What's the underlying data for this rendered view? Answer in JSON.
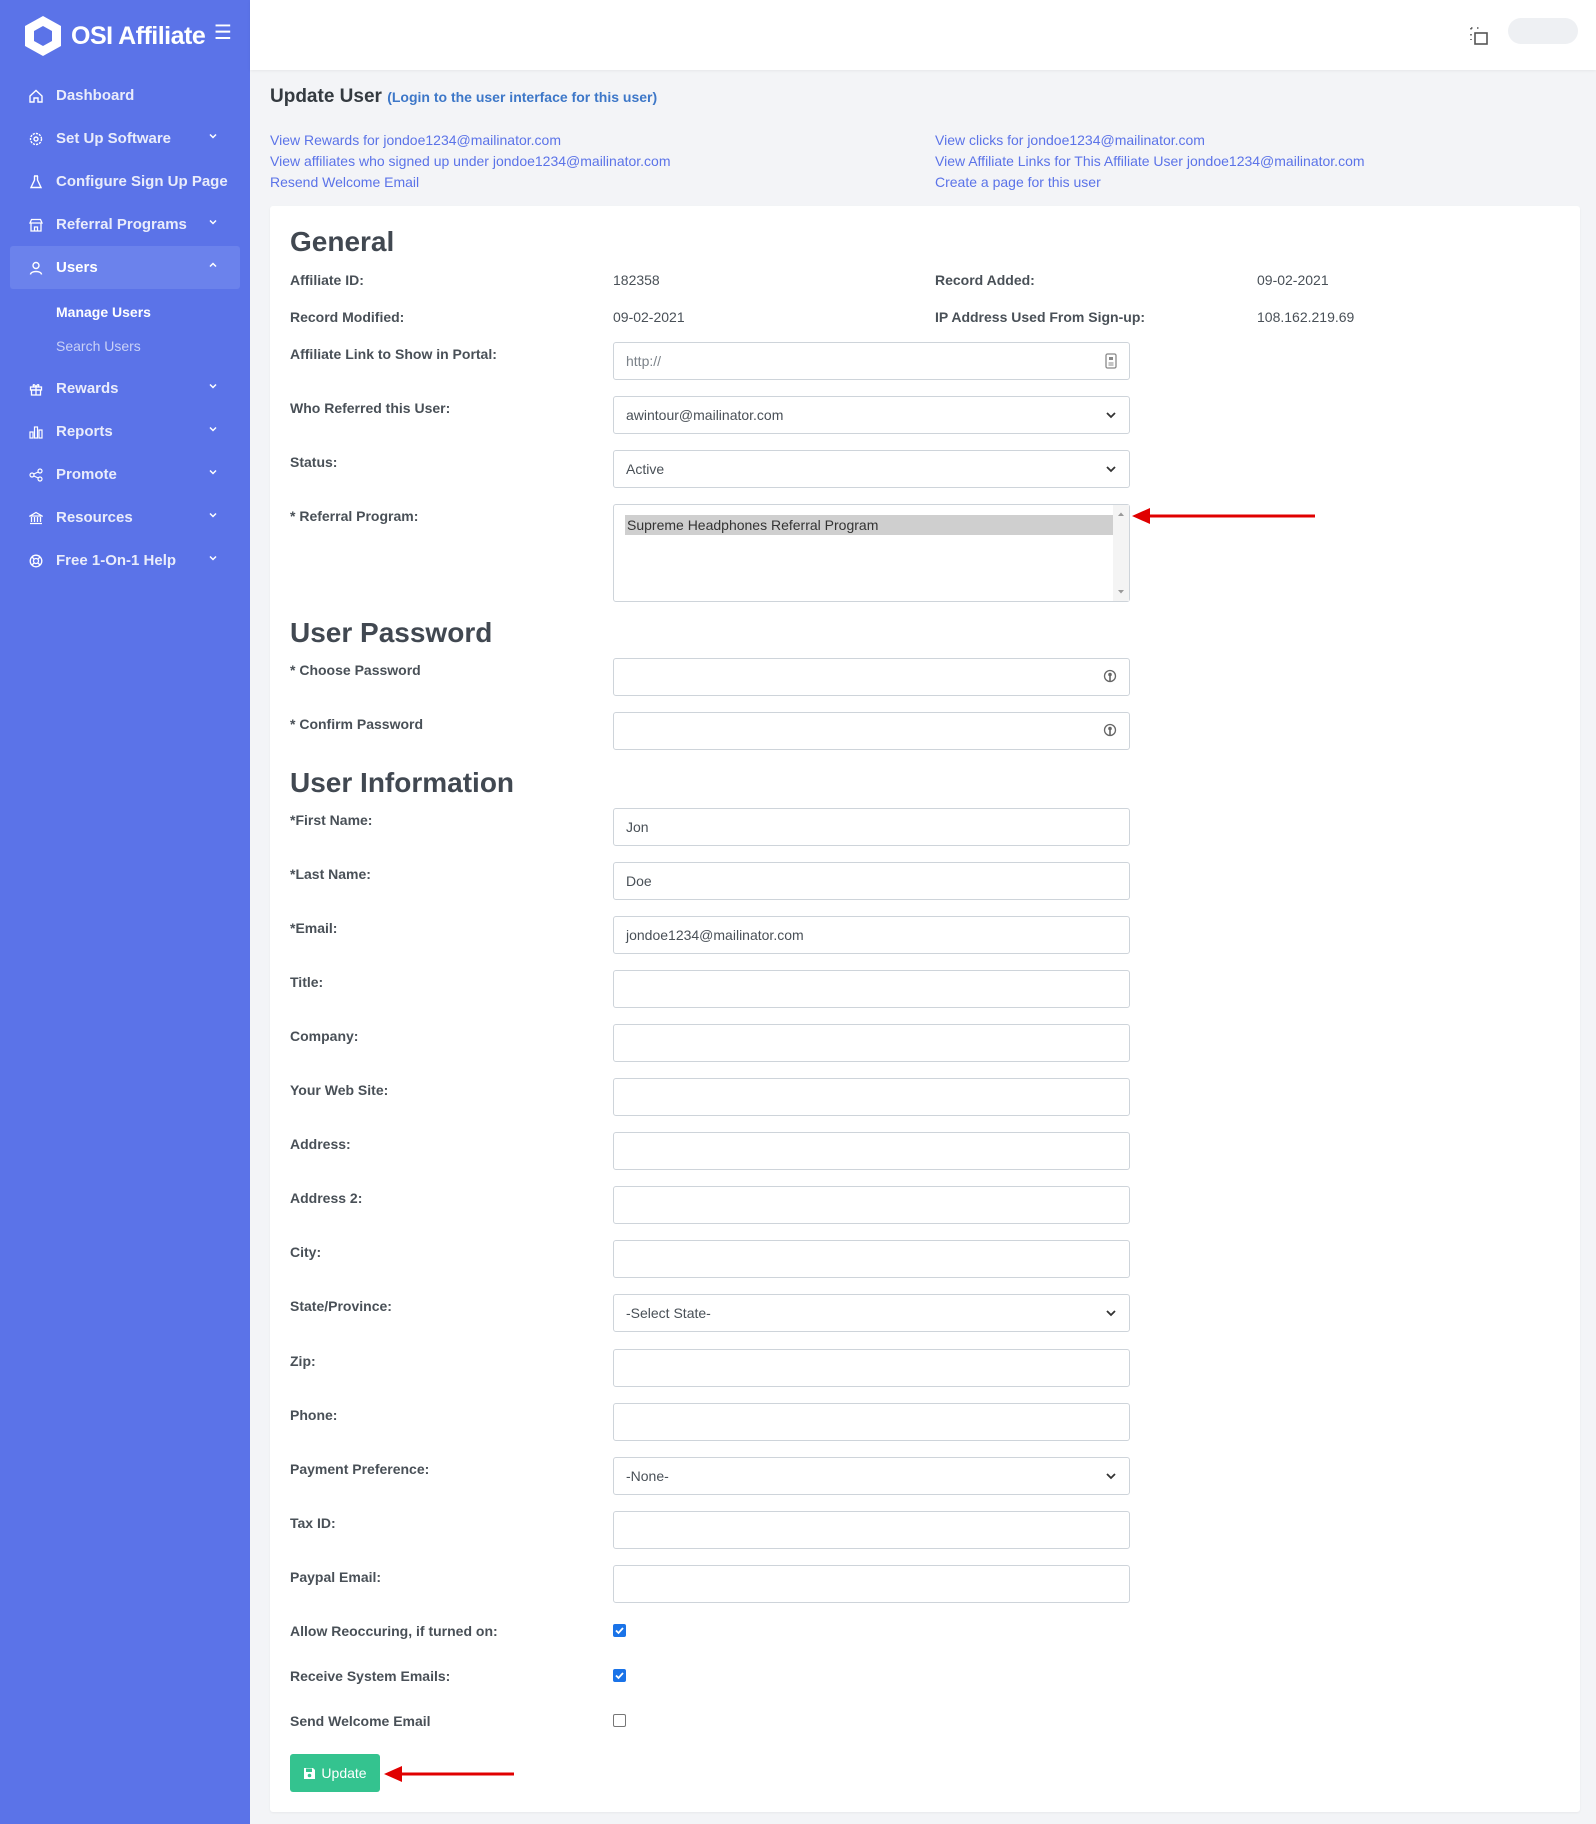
{
  "brand": {
    "name": "OSI Affiliate"
  },
  "sidebar": {
    "items": [
      {
        "label": "Dashboard",
        "icon": "home-icon",
        "has_chevron": false
      },
      {
        "label": "Set Up Software",
        "icon": "gear-icon",
        "has_chevron": true
      },
      {
        "label": "Configure Sign Up Page",
        "icon": "flask-icon",
        "has_chevron": false
      },
      {
        "label": "Referral Programs",
        "icon": "store-icon",
        "has_chevron": true
      },
      {
        "label": "Users",
        "icon": "user-icon",
        "has_chevron": true,
        "active": true
      },
      {
        "label": "Rewards",
        "icon": "gift-icon",
        "has_chevron": true
      },
      {
        "label": "Reports",
        "icon": "bar-chart-icon",
        "has_chevron": true
      },
      {
        "label": "Promote",
        "icon": "share-icon",
        "has_chevron": true
      },
      {
        "label": "Resources",
        "icon": "bank-icon",
        "has_chevron": true
      },
      {
        "label": "Free 1-On-1 Help",
        "icon": "lifebuoy-icon",
        "has_chevron": true
      }
    ],
    "users_sub": [
      "Manage Users",
      "Search Users"
    ]
  },
  "page": {
    "title": "Update User",
    "login_link": "(Login to the user interface for this user)",
    "links_left": [
      "View Rewards for jondoe1234@mailinator.com",
      "View affiliates who signed up under jondoe1234@mailinator.com",
      "Resend Welcome Email"
    ],
    "links_right": [
      "View clicks for jondoe1234@mailinator.com",
      "View Affiliate Links for This Affiliate User jondoe1234@mailinator.com",
      "Create a page for this user"
    ]
  },
  "general": {
    "title": "General",
    "affiliate_id_label": "Affiliate ID:",
    "affiliate_id": "182358",
    "record_added_label": "Record Added:",
    "record_added": "09-02-2021",
    "record_modified_label": "Record Modified:",
    "record_modified": "09-02-2021",
    "ip_label": "IP Address Used From Sign-up:",
    "ip": "108.162.219.69",
    "affiliate_link_label": "Affiliate Link to Show in Portal:",
    "affiliate_link_placeholder": "http://",
    "referred_by_label": "Who Referred this User:",
    "referred_by": "awintour@mailinator.com",
    "status_label": "Status:",
    "status": "Active",
    "referral_program_label": "* Referral Program:",
    "referral_program_selected": "Supreme Headphones Referral Program"
  },
  "password": {
    "title": "User Password",
    "choose_label": "* Choose Password",
    "confirm_label": "* Confirm Password"
  },
  "info": {
    "title": "User Information",
    "first_name_label": "*First Name:",
    "first_name": "Jon",
    "last_name_label": "*Last Name:",
    "last_name": "Doe",
    "email_label": "*Email:",
    "email": "jondoe1234@mailinator.com",
    "title_label": "Title:",
    "company_label": "Company:",
    "website_label": "Your Web Site:",
    "address_label": "Address:",
    "address2_label": "Address 2:",
    "city_label": "City:",
    "state_label": "State/Province:",
    "state": "-Select State-",
    "zip_label": "Zip:",
    "phone_label": "Phone:",
    "payment_label": "Payment Preference:",
    "payment": "-None-",
    "tax_label": "Tax ID:",
    "paypal_label": "Paypal Email:",
    "allow_recurring_label": "Allow Reoccuring, if turned on:",
    "allow_recurring": true,
    "system_emails_label": "Receive System Emails:",
    "system_emails": true,
    "welcome_email_label": "Send Welcome Email",
    "welcome_email": false
  },
  "actions": {
    "update_label": "Update"
  },
  "colors": {
    "sidebar": "#5b73e8",
    "accent": "#34c38f",
    "annotation_arrow": "#e00000"
  }
}
